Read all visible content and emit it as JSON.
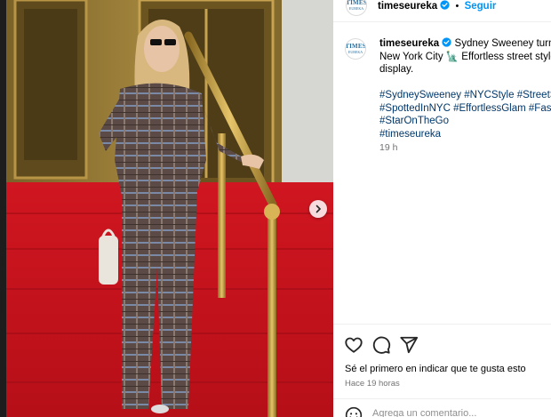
{
  "post": {
    "username": "timeseureka",
    "follow_label": "Seguir",
    "separator": "•",
    "avatar_text_top": "TIMES",
    "avatar_text_bottom": "EUREKA",
    "caption_line1": "Sydney Sweeney turns he",
    "caption_line2": "New York City 🗽 Effortless street style a",
    "caption_line3": "display.",
    "hashtags": [
      "#SydneySweeney #NYCStyle #StreetStyle",
      "#SpottedInNYC #EffortlessGlam #Fashio",
      "#StarOnTheGo",
      "#timeseureka"
    ],
    "time_short": "19 h",
    "likes_text": "Sé el primero en indicar que te gusta esto",
    "posted_text": "Hace 19 horas",
    "comment_placeholder": "Agrega un comentario..."
  },
  "icons": {
    "like": "heart-icon",
    "comment": "comment-icon",
    "share": "share-icon",
    "next": "chevron-right-icon",
    "emoji": "emoji-icon",
    "verified": "verified-badge-icon"
  },
  "colors": {
    "link_blue": "#0095f6",
    "hashtag_blue": "#00376b",
    "muted_gray": "#737373",
    "carpet_red": "#c8141e",
    "brass": "#c9a24a"
  }
}
